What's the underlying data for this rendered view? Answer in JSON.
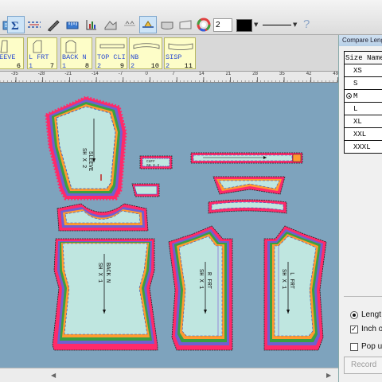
{
  "toolbar": {
    "pen_width": "2",
    "icons": [
      "grade-icon",
      "sum-icon",
      "measure-icon",
      "pencil-icon",
      "ruler-icon",
      "spec-table-icon",
      "shape-icon",
      "align-icon",
      "fold-icon",
      "notch-icon",
      "color-wheel-icon",
      "help-icon"
    ]
  },
  "pieces": [
    {
      "label": "LEEVE",
      "qty": "6",
      "total": "1"
    },
    {
      "label": "L FRT",
      "qty": "1",
      "total": "7"
    },
    {
      "label": "BACK N",
      "qty": "1",
      "total": "8"
    },
    {
      "label": "TOP CLI",
      "qty": "2",
      "total": "9"
    },
    {
      "label": "NB",
      "qty": "2",
      "total": "10"
    },
    {
      "label": "SISP",
      "qty": "2",
      "total": "11"
    }
  ],
  "ruler": {
    "labels": [
      "-35",
      "-28",
      "-21",
      "-14",
      "-7",
      "0",
      "7",
      "14",
      "21",
      "28",
      "35",
      "42",
      "49"
    ]
  },
  "canvas": {
    "piece_labels": {
      "sleeve": "SLEEVE",
      "sleeve_qty": "SH X 2",
      "back": "BACK N",
      "back_qty": "SH X 1",
      "r_front": "R FRT",
      "r_front_qty": "SH X 1",
      "l_front": "L FRT",
      "l_front_qty": "SH X 1",
      "cuff": "CUFF",
      "cuff_qty": "SH X 2"
    }
  },
  "panel": {
    "title": "Compare Length",
    "header": "Size Name",
    "sizes": [
      "XS",
      "S",
      "M",
      "L",
      "XL",
      "XXL",
      "XXXL"
    ],
    "selected_size": "M",
    "options": {
      "length_label": "Lengt",
      "inch_label": "Inch o",
      "popup_label": "Pop u"
    },
    "record_label": "Record"
  },
  "colors": {
    "canvas_bg": "#7ea3bd",
    "piece_fill": "#bfe6e0",
    "grade_outer": "#ff2a6a",
    "piece_label": "#2a4bd0"
  }
}
